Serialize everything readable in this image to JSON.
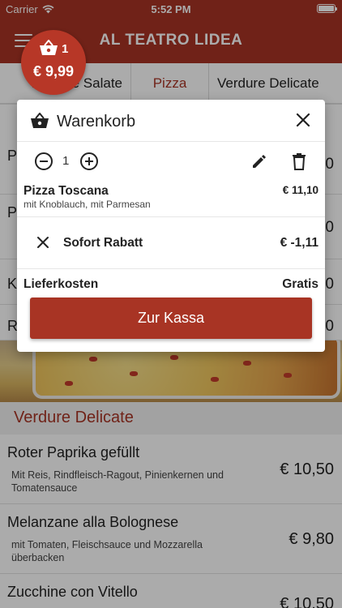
{
  "status_bar": {
    "carrier": "Carrier",
    "time": "5:52 PM"
  },
  "app_bar": {
    "title": "AL TEATRO LIDEA"
  },
  "cart_badge": {
    "count": "1",
    "total": "€ 9,99"
  },
  "tabs": [
    {
      "label": "Insalate Salate"
    },
    {
      "label": "Pizza"
    },
    {
      "label": "Verdure Delicate"
    }
  ],
  "background_rows": [
    {
      "letter": "P",
      "price": "0"
    },
    {
      "letter": "P",
      "price": "0"
    },
    {
      "letter": "K",
      "price": "0"
    },
    {
      "letter": "R",
      "price": "0"
    }
  ],
  "section": {
    "title": "Verdure Delicate"
  },
  "dishes": [
    {
      "name": "Roter Paprika gefüllt",
      "description": "Mit Reis, Rindfleisch-Ragout, Pinienkernen und Tomatensauce",
      "price": "€ 10,50"
    },
    {
      "name": "Melanzane alla Bolognese",
      "description": "mit Tomaten, Fleischsauce und Mozzarella überbacken",
      "price": "€ 9,80"
    },
    {
      "name": "Zucchine con Vitello",
      "description": "",
      "price": "€ 10,50"
    }
  ],
  "modal": {
    "title": "Warenkorb",
    "quantity": "1",
    "item": {
      "name": "Pizza Toscana",
      "options": "mit Knoblauch, mit Parmesan",
      "price": "€ 11,10"
    },
    "discount": {
      "label": "Sofort Rabatt",
      "price": "€ -1,11"
    },
    "delivery": {
      "label": "Lieferkosten",
      "value": "Gratis"
    },
    "checkout_label": "Zur Kassa"
  },
  "colors": {
    "brand": "#a83424",
    "badge": "#b73727"
  }
}
